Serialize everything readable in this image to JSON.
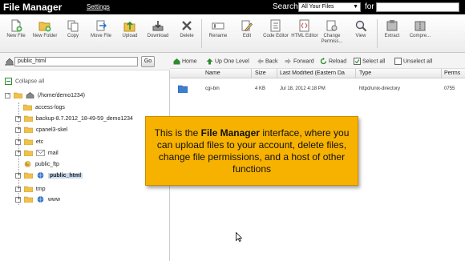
{
  "titlebar": {
    "title": "File Manager",
    "settings": "Settings",
    "search_label": "Search",
    "search_scope": "All Your Files",
    "for_label": "for",
    "search_value": ""
  },
  "toolbar": {
    "buttons": [
      {
        "label": "New File",
        "icon": "new-file-icon"
      },
      {
        "label": "New Folder",
        "icon": "new-folder-icon"
      },
      {
        "label": "Copy",
        "icon": "copy-icon"
      },
      {
        "label": "Move File",
        "icon": "move-file-icon"
      },
      {
        "label": "Upload",
        "icon": "upload-icon"
      },
      {
        "label": "Download",
        "icon": "download-icon"
      },
      {
        "label": "Delete",
        "icon": "delete-icon"
      },
      {
        "label": "Rename",
        "icon": "rename-icon"
      },
      {
        "label": "Edit",
        "icon": "edit-icon"
      },
      {
        "label": "Code Editor",
        "icon": "code-editor-icon"
      },
      {
        "label": "HTML Editor",
        "icon": "html-editor-icon"
      },
      {
        "label": "Change Permiss...",
        "icon": "change-permissions-icon"
      },
      {
        "label": "View",
        "icon": "view-icon"
      },
      {
        "label": "Extract",
        "icon": "extract-icon"
      },
      {
        "label": "Compre...",
        "icon": "compress-icon"
      }
    ]
  },
  "left": {
    "path_value": "public_html",
    "go_label": "Go",
    "collapse_all": "Collapse all",
    "tree": [
      {
        "label": "(/home/demo1234)",
        "icon": "home-icon"
      },
      {
        "label": "access-logs",
        "icon": "folder-icon"
      },
      {
        "label": "backup-8.7.2012_18-49-59_demo1234",
        "icon": "folder-icon"
      },
      {
        "label": "cpanel3-skel",
        "icon": "folder-icon"
      },
      {
        "label": "etc",
        "icon": "folder-icon"
      },
      {
        "label": "mail",
        "icon": "mail-folder-icon"
      },
      {
        "label": "public_ftp",
        "icon": "ftp-folder-icon"
      },
      {
        "label": "public_html",
        "icon": "web-folder-icon"
      },
      {
        "label": "tmp",
        "icon": "folder-icon"
      },
      {
        "label": "www",
        "icon": "web-folder-icon"
      }
    ]
  },
  "nav": {
    "home": "Home",
    "up": "Up One Level",
    "back": "Back",
    "forward": "Forward",
    "reload": "Reload",
    "select_all": "Select all",
    "unselect_all": "Unselect all"
  },
  "grid": {
    "headers": [
      "Name",
      "Size",
      "Last Modified (Eastern Da",
      "Type",
      "Perms"
    ],
    "rows": [
      {
        "name": "cgi-bin",
        "size": "4 KB",
        "modified": "Jul 18, 2012 4:18 PM",
        "type": "httpd/unix-directory",
        "perms": "0755"
      }
    ]
  },
  "callout": {
    "pre": "This is the ",
    "bold": "File Manager",
    "post": " interface, where you can upload files to your account, delete files, change file permissions, and a host of other functions"
  },
  "colors": {
    "accent": "#f7b200",
    "titlebar": "#000000",
    "selection": "#c9dcee"
  }
}
